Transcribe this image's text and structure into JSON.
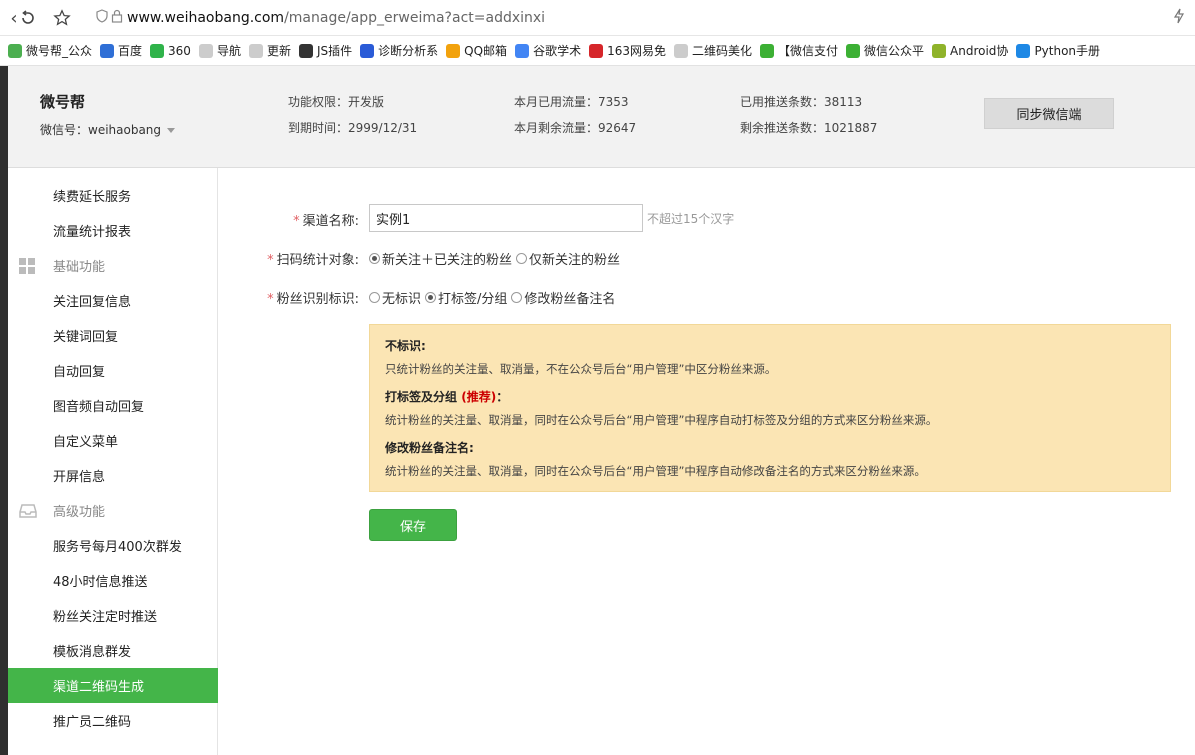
{
  "browser": {
    "url_main": "www.weihaobang.com",
    "url_path": "/manage/app_erweima?act=addxinxi"
  },
  "bookmarks": [
    {
      "label": "微号帮_公众",
      "icon": "weihaobang-icon",
      "color": "#4caf50"
    },
    {
      "label": "百度",
      "icon": "baidu-paw-icon",
      "color": "#2f6fd6"
    },
    {
      "label": "360",
      "icon": "360-icon",
      "color": "#2fb34a"
    },
    {
      "label": "导航",
      "icon": "page-icon",
      "color": "#cccccc"
    },
    {
      "label": "更新",
      "icon": "page-icon",
      "color": "#cccccc"
    },
    {
      "label": "JS插件",
      "icon": "js-icon",
      "color": "#333333"
    },
    {
      "label": "诊断分析系",
      "icon": "diagnosis-icon",
      "color": "#2a5bd7"
    },
    {
      "label": "QQ邮箱",
      "icon": "qq-mail-icon",
      "color": "#f2a20d"
    },
    {
      "label": "谷歌学术",
      "icon": "google-icon",
      "color": "#4285f4"
    },
    {
      "label": "163网易免",
      "icon": "netease-icon",
      "color": "#d6262a"
    },
    {
      "label": "二维码美化",
      "icon": "page-icon",
      "color": "#cccccc"
    },
    {
      "label": "【微信支付",
      "icon": "wechat-icon",
      "color": "#3cb034"
    },
    {
      "label": "微信公众平",
      "icon": "wechat-icon",
      "color": "#3cb034"
    },
    {
      "label": "Android协",
      "icon": "android-icon",
      "color": "#8fb32a"
    },
    {
      "label": "Python手册",
      "icon": "python-icon",
      "color": "#1e88e5"
    }
  ],
  "header": {
    "account_name": "微号帮",
    "account_id": "微信号：weihaobang",
    "stats": [
      {
        "text": "功能权限：开发版"
      },
      {
        "text": "到期时间：2999/12/31"
      },
      {
        "text": "本月已用流量：7353"
      },
      {
        "text": "本月剩余流量：92647"
      },
      {
        "text": "已用推送条数：38113"
      },
      {
        "text": "剩余推送条数：1021887"
      }
    ],
    "sync_button": "同步微信端"
  },
  "sidebar": {
    "items": [
      {
        "label": "续费延长服务",
        "type": "item"
      },
      {
        "label": "流量统计报表",
        "type": "item"
      },
      {
        "label": "基础功能",
        "type": "section"
      },
      {
        "label": "关注回复信息",
        "type": "item"
      },
      {
        "label": "关键词回复",
        "type": "item"
      },
      {
        "label": "自动回复",
        "type": "item"
      },
      {
        "label": "图音频自动回复",
        "type": "item"
      },
      {
        "label": "自定义菜单",
        "type": "item"
      },
      {
        "label": "开屏信息",
        "type": "item"
      },
      {
        "label": "高级功能",
        "type": "section"
      },
      {
        "label": "服务号每月400次群发",
        "type": "item"
      },
      {
        "label": "48小时信息推送",
        "type": "item"
      },
      {
        "label": "粉丝关注定时推送",
        "type": "item"
      },
      {
        "label": "模板消息群发",
        "type": "item"
      },
      {
        "label": "渠道二维码生成",
        "type": "item",
        "active": true
      },
      {
        "label": "推广员二维码",
        "type": "item"
      }
    ],
    "active_color": "#44b549"
  },
  "form": {
    "name_label": "渠道名称:",
    "name_value": "实例1",
    "name_hint": "不超过15个汉字",
    "target_label": "扫码统计对象:",
    "target_options": [
      "新关注＋已关注的粉丝",
      "仅新关注的粉丝"
    ],
    "target_selected": 0,
    "mark_label": "粉丝识别标识:",
    "mark_options": [
      "无标识",
      "打标签/分组",
      "修改粉丝备注名"
    ],
    "mark_selected": 1,
    "required_mark": "*",
    "save_button": "保存"
  },
  "notice": {
    "title1": "不标识:",
    "text1": "只统计粉丝的关注量、取消量，不在公众号后台“用户管理”中区分粉丝来源。",
    "title2": "打标签及分组",
    "title2_rec": "(推荐)",
    "title2_suffix": "：",
    "text2": "统计粉丝的关注量、取消量，同时在公众号后台“用户管理”中程序自动打标签及分组的方式来区分粉丝来源。",
    "title3": "修改粉丝备注名:",
    "text3": "统计粉丝的关注量、取消量，同时在公众号后台“用户管理”中程序自动修改备注名的方式来区分粉丝来源。"
  }
}
